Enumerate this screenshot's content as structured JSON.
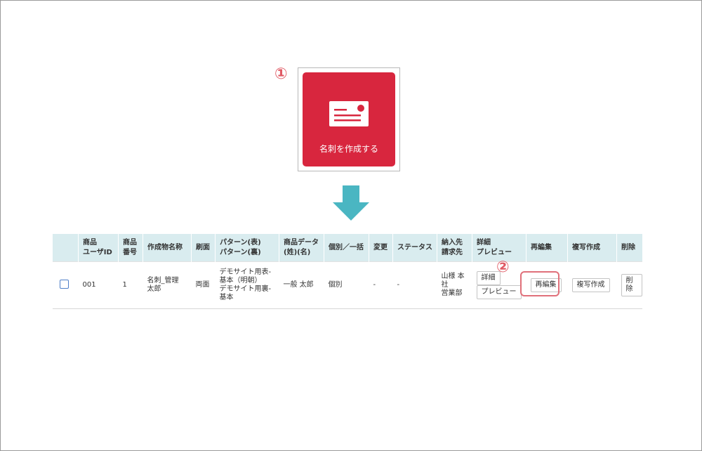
{
  "steps": {
    "step1": "①",
    "step2": "②"
  },
  "create_card": {
    "label": "名刺を作成する",
    "color": "#d8263e"
  },
  "arrow_color": "#4ab6c2",
  "table": {
    "header_bg": "#d9ecef",
    "headers": {
      "product_user_id": [
        "商品",
        "ユーザID"
      ],
      "product_no": [
        "商品",
        "番号"
      ],
      "creation_name": "作成物名称",
      "print_side": "刷面",
      "pattern": [
        "パターン(表)",
        "パターン(裏)"
      ],
      "product_data": [
        "商品データ",
        "(姓)(名)"
      ],
      "individual_bulk": "個別／一括",
      "change": "変更",
      "status": "ステータス",
      "delivery": [
        "納入先",
        "請求先"
      ],
      "detail_preview": [
        "詳細",
        "プレビュー"
      ],
      "reedit": "再編集",
      "duplicate": "複写作成",
      "delete": "削除"
    },
    "row": {
      "user_id": "001",
      "product_no": "1",
      "creation_name": [
        "名刺_管理",
        "太郎"
      ],
      "print_side": "両面",
      "pattern": [
        "デモサイト用表-",
        "基本（明朝）",
        "デモサイト用裏-",
        "基本"
      ],
      "product_data": "一般 太郎",
      "individual_bulk": "個別",
      "change": "-",
      "status": "-",
      "delivery": [
        "山様 本",
        "社",
        "営業部"
      ],
      "detail_button": "詳細",
      "preview_button": "プレビュー",
      "reedit_button": "再編集",
      "duplicate_button": "複写作成",
      "delete_button": "削除"
    }
  }
}
